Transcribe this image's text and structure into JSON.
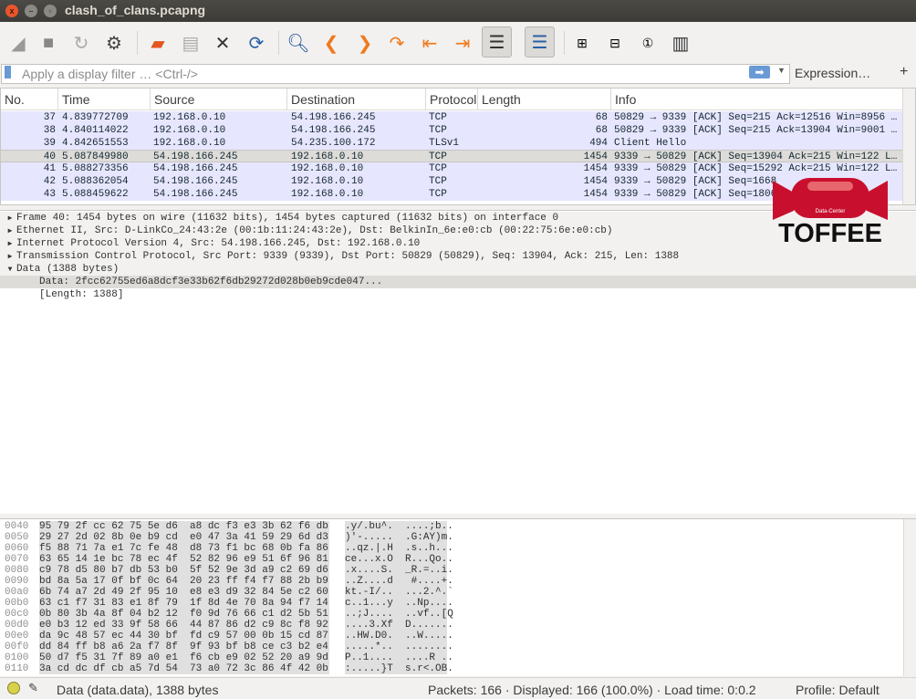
{
  "window": {
    "title": "clash_of_clans.pcapng",
    "close": "x"
  },
  "toolbar": {
    "icons": [
      "start-capture-icon",
      "stop-capture-icon",
      "restart-capture-icon",
      "capture-options-icon",
      "open-file-icon",
      "save-file-icon",
      "close-file-icon",
      "reload-file-icon",
      "find-packet-icon",
      "go-back-icon",
      "go-forward-icon",
      "go-to-packet-icon",
      "first-packet-icon",
      "last-packet-icon",
      "autoscroll-icon",
      "colorize-icon",
      "zoom-in-icon",
      "zoom-out-icon",
      "normal-size-icon",
      "resize-columns-icon"
    ]
  },
  "filter": {
    "placeholder": "Apply a display filter … <Ctrl-/>",
    "apply": "➡",
    "expression": "Expression…",
    "plus": "+"
  },
  "packet_list": {
    "columns": [
      "No.",
      "Time",
      "Source",
      "Destination",
      "Protocol",
      "Length",
      "Info"
    ],
    "rows": [
      {
        "no": "37",
        "time": "4.839772709",
        "src": "192.168.0.10",
        "dst": "54.198.166.245",
        "proto": "TCP",
        "len": "68",
        "info": "50829 → 9339 [ACK] Seq=215 Ack=12516 Win=8956 …"
      },
      {
        "no": "38",
        "time": "4.840114022",
        "src": "192.168.0.10",
        "dst": "54.198.166.245",
        "proto": "TCP",
        "len": "68",
        "info": "50829 → 9339 [ACK] Seq=215 Ack=13904 Win=9001 …"
      },
      {
        "no": "39",
        "time": "4.842651553",
        "src": "192.168.0.10",
        "dst": "54.235.100.172",
        "proto": "TLSv1",
        "len": "494",
        "info": "Client Hello"
      },
      {
        "no": "40",
        "time": "5.087849980",
        "src": "54.198.166.245",
        "dst": "192.168.0.10",
        "proto": "TCP",
        "len": "1454",
        "info": "9339 → 50829 [ACK] Seq=13904 Ack=215 Win=122 L…",
        "selected": true
      },
      {
        "no": "41",
        "time": "5.088273356",
        "src": "54.198.166.245",
        "dst": "192.168.0.10",
        "proto": "TCP",
        "len": "1454",
        "info": "9339 → 50829 [ACK] Seq=15292 Ack=215 Win=122 L…"
      },
      {
        "no": "42",
        "time": "5.088362054",
        "src": "54.198.166.245",
        "dst": "192.168.0.10",
        "proto": "TCP",
        "len": "1454",
        "info": "9339 → 50829 [ACK] Seq=1668"
      },
      {
        "no": "43",
        "time": "5.088459622",
        "src": "54.198.166.245",
        "dst": "192.168.0.10",
        "proto": "TCP",
        "len": "1454",
        "info": "9339 → 50829 [ACK] Seq=1806"
      }
    ]
  },
  "details": [
    {
      "text": "Frame 40: 1454 bytes on wire (11632 bits), 1454 bytes captured (11632 bits) on interface 0",
      "expanded": false
    },
    {
      "text": "Ethernet II, Src: D-LinkCo_24:43:2e (00:1b:11:24:43:2e), Dst: BelkinIn_6e:e0:cb (00:22:75:6e:e0:cb)",
      "expanded": false
    },
    {
      "text": "Internet Protocol Version 4, Src: 54.198.166.245, Dst: 192.168.0.10",
      "expanded": false
    },
    {
      "text": "Transmission Control Protocol, Src Port: 9339 (9339), Dst Port: 50829 (50829), Seq: 13904, Ack: 215, Len: 1388",
      "expanded": false
    },
    {
      "text": "Data (1388 bytes)",
      "expanded": true
    },
    {
      "text": "Data: 2fcc62755ed6a8dcf3e33b62f6db29272d028b0eb9cde047...",
      "child": true,
      "selected": true
    },
    {
      "text": "[Length: 1388]",
      "child": true
    }
  ],
  "hex": [
    {
      "off": "0040",
      "hex": "95 79 2f cc 62 75 5e d6  a8 dc f3 e3 3b 62 f6 db",
      "ascii": ".y/.bu^.  ....;b.."
    },
    {
      "off": "0050",
      "hex": "29 27 2d 02 8b 0e b9 cd  e0 47 3a 41 59 29 6d d3",
      "ascii": ")'-.....  .G:AY)m."
    },
    {
      "off": "0060",
      "hex": "f5 88 71 7a e1 7c fe 48  d8 73 f1 bc 68 0b fa 86",
      "ascii": "..qz.|.H  .s..h..."
    },
    {
      "off": "0070",
      "hex": "63 65 14 1e bc 78 ec 4f  52 82 96 e9 51 6f 96 81",
      "ascii": "ce...x.O  R...Qo.."
    },
    {
      "off": "0080",
      "hex": "c9 78 d5 80 b7 db 53 b0  5f 52 9e 3d a9 c2 69 d6",
      "ascii": ".x....S.  _R.=..i."
    },
    {
      "off": "0090",
      "hex": "bd 8a 5a 17 0f bf 0c 64  20 23 ff f4 f7 88 2b b9",
      "ascii": "..Z....d   #....+."
    },
    {
      "off": "00a0",
      "hex": "6b 74 a7 2d 49 2f 95 10  e8 e3 d9 32 84 5e c2 60",
      "ascii": "kt.-I/..  ...2.^.`"
    },
    {
      "off": "00b0",
      "hex": "63 c1 f7 31 83 e1 8f 79  1f 8d 4e 70 8a 94 f7 14",
      "ascii": "c..1...y  ..Np...."
    },
    {
      "off": "00c0",
      "hex": "0b 80 3b 4a 8f 04 b2 12  f0 9d 76 66 c1 d2 5b 51",
      "ascii": "..;J....  ..vf..[Q"
    },
    {
      "off": "00d0",
      "hex": "e0 b3 12 ed 33 9f 58 66  44 87 86 d2 c9 8c f8 92",
      "ascii": "....3.Xf  D......."
    },
    {
      "off": "00e0",
      "hex": "da 9c 48 57 ec 44 30 bf  fd c9 57 00 0b 15 cd 87",
      "ascii": "..HW.D0.  ..W....."
    },
    {
      "off": "00f0",
      "hex": "dd 84 ff b8 a6 2a f7 8f  9f 93 bf b8 ce c3 b2 e4",
      "ascii": ".....*..  ........"
    },
    {
      "off": "0100",
      "hex": "50 d7 f5 31 7f 89 a0 e1  f6 cb e9 02 52 20 a9 9d",
      "ascii": "P..1....  ....R .."
    },
    {
      "off": "0110",
      "hex": "3a cd dc df cb a5 7d 54  73 a0 72 3c 86 4f 42 0b",
      "ascii": ":.....}T  s.r<.OB."
    }
  ],
  "status": {
    "field": "Data (data.data), 1388 bytes",
    "packets": "Packets: 166 · Displayed: 166 (100.0%) · Load time: 0:0.2",
    "profile": "Profile: Default"
  },
  "watermark": {
    "name": "TOFFEE",
    "sub": "Data-Center"
  },
  "colors": {
    "row_bg": "#e7e6ff",
    "selected_row": "#dddcd9",
    "accent": "#6a9ad6",
    "logo_red": "#c8102e"
  }
}
